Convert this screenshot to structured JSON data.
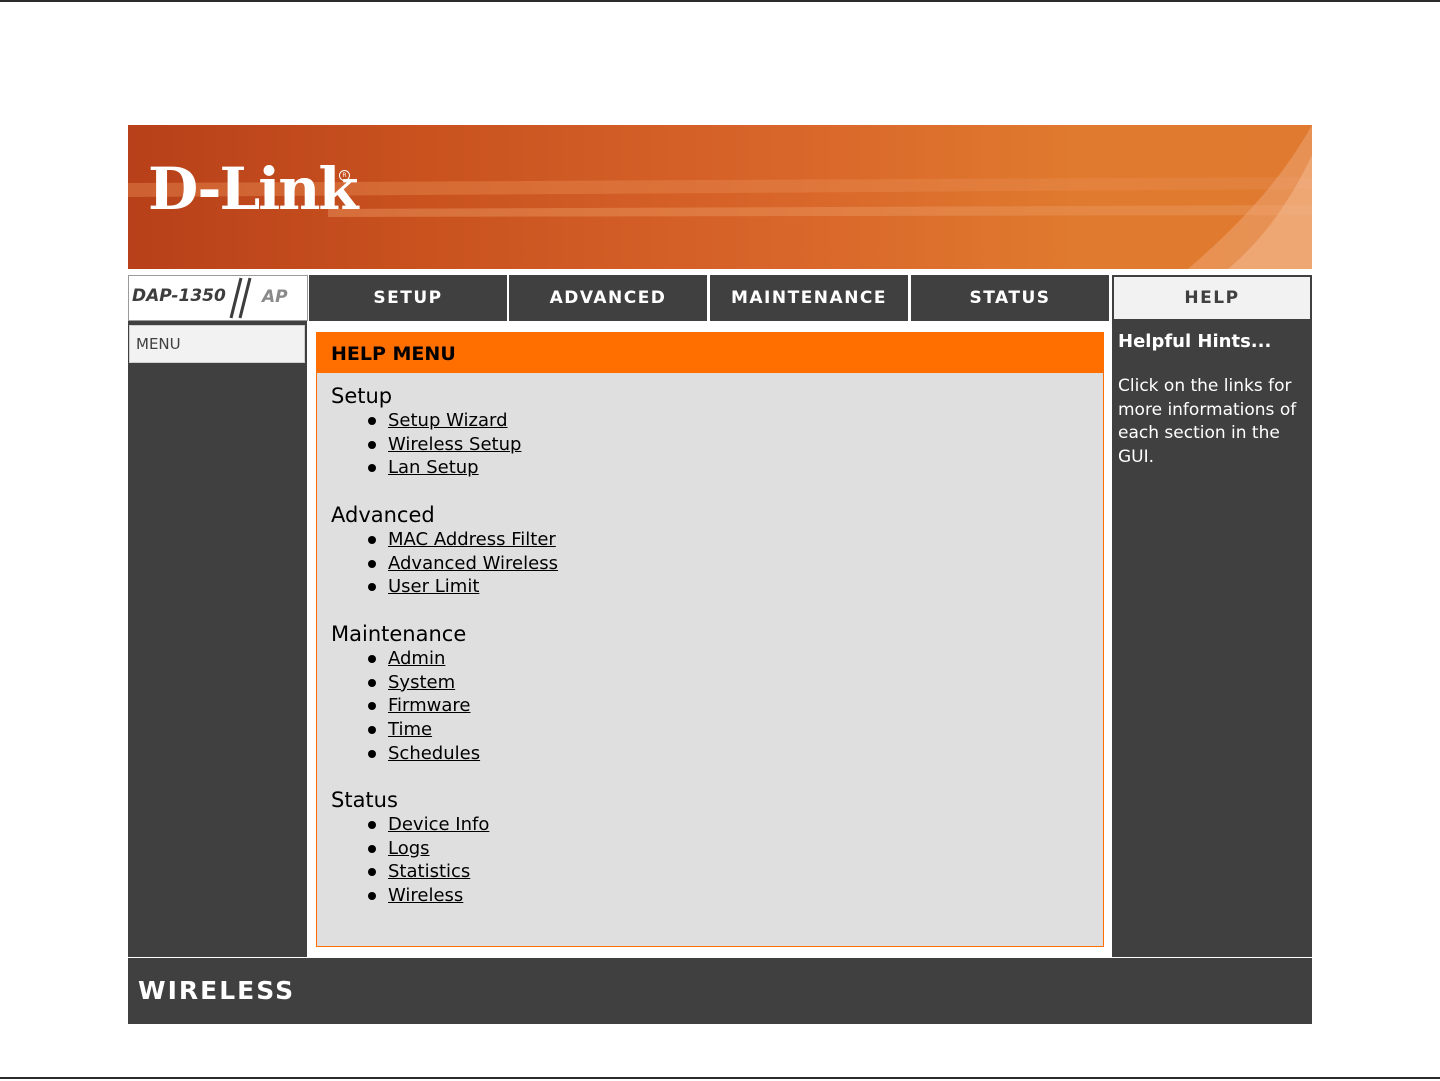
{
  "brand": {
    "logo": "D-Link",
    "model": "DAP-1350",
    "mode": "AP",
    "footer_label": "WIRELESS",
    "colors": {
      "accent": "#ff6f00",
      "dark": "#404040",
      "panel": "#dfdfdf"
    }
  },
  "nav": {
    "tabs": [
      {
        "label": "SETUP",
        "active": false
      },
      {
        "label": "ADVANCED",
        "active": false
      },
      {
        "label": "MAINTENANCE",
        "active": false
      },
      {
        "label": "STATUS",
        "active": false
      },
      {
        "label": "HELP",
        "active": true
      }
    ]
  },
  "sidebar": {
    "items": [
      {
        "label": "MENU"
      }
    ]
  },
  "main": {
    "panel_title": "HELP MENU",
    "sections": [
      {
        "title": "Setup",
        "links": [
          "Setup Wizard",
          "Wireless Setup",
          "Lan Setup"
        ]
      },
      {
        "title": "Advanced",
        "links": [
          "MAC Address Filter",
          "Advanced Wireless",
          "User Limit"
        ]
      },
      {
        "title": "Maintenance",
        "links": [
          "Admin",
          "System",
          "Firmware",
          "Time",
          "Schedules"
        ]
      },
      {
        "title": "Status",
        "links": [
          "Device Info",
          "Logs",
          "Statistics",
          "Wireless"
        ]
      }
    ]
  },
  "hints": {
    "title": "Helpful Hints...",
    "text": "Click on the links for more informations of each section in the GUI."
  }
}
